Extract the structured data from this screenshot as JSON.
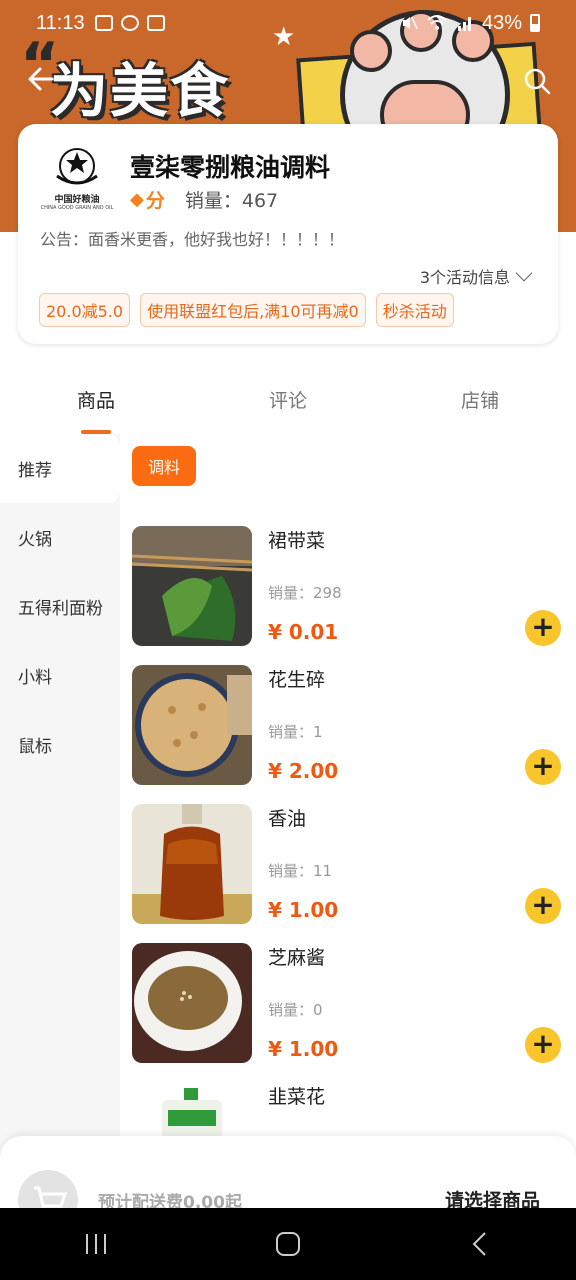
{
  "status": {
    "time": "11:13",
    "battery": "43%"
  },
  "banner": {
    "text": "为美食"
  },
  "shop": {
    "name": "壹柒零捌粮油调料",
    "logo_text": "中国好粮油",
    "logo_sub": "CHINA GOOD GRAIN AND OIL",
    "score": "分",
    "sales": "销量：467",
    "notice": "公告：面香米更香，他好我也好！！！！！",
    "activity_info": "3个活动信息",
    "promos": [
      "20.0减5.0",
      "使用联盟红包后,满10可再减0",
      "秒杀活动"
    ]
  },
  "tabs": [
    "商品",
    "评论",
    "店铺"
  ],
  "categories": [
    "推荐",
    "火锅",
    "五得利面粉",
    "小料",
    "鼠标"
  ],
  "group_chip": "调料",
  "products": [
    {
      "name": "裙带菜",
      "sales": "销量：298",
      "price": "¥ 0.01"
    },
    {
      "name": "花生碎",
      "sales": "销量：1",
      "price": "¥ 2.00"
    },
    {
      "name": "香油",
      "sales": "销量：11",
      "price": "¥ 1.00"
    },
    {
      "name": "芝麻酱",
      "sales": "销量：0",
      "price": "¥ 1.00"
    },
    {
      "name": "韭菜花",
      "sales": "",
      "price": ""
    }
  ],
  "cart": {
    "delivery": "预计配送费0.00起",
    "select": "请选择商品"
  },
  "colors": {
    "accent": "#fb6b12",
    "price": "#ef5a12",
    "add_button": "#f8c52d"
  }
}
